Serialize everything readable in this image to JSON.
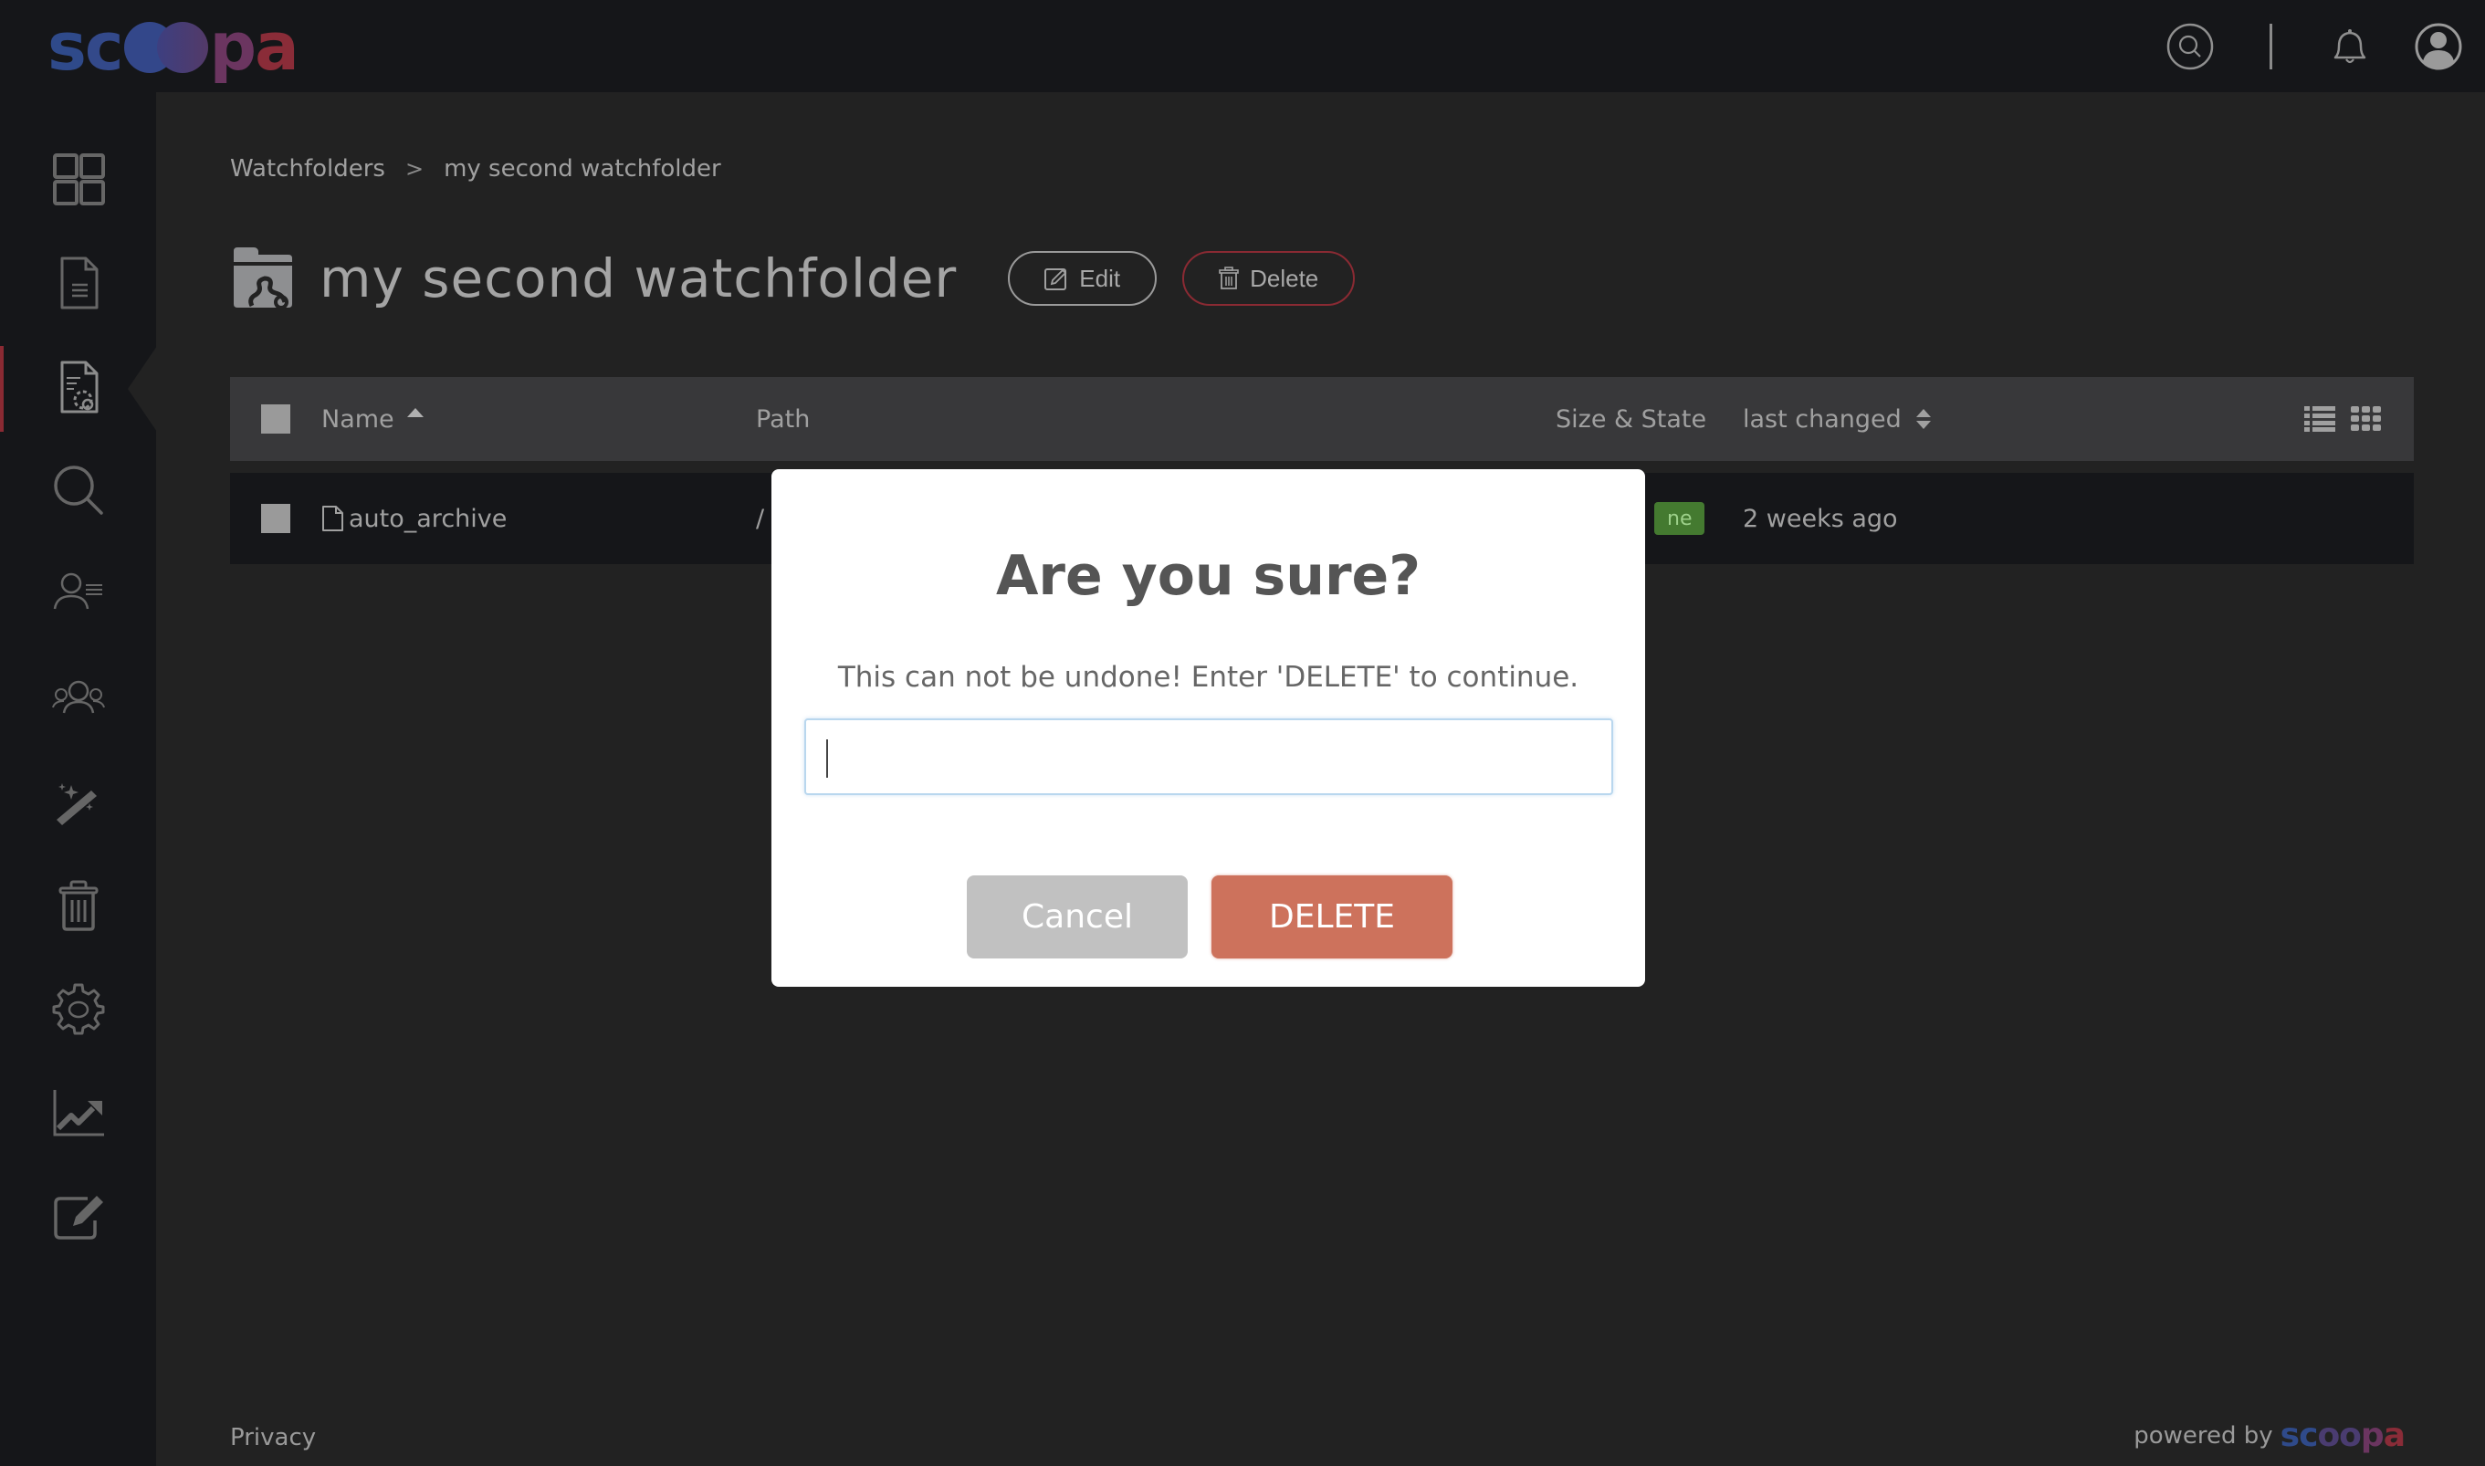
{
  "app": {
    "logo_text": "scoopa",
    "logo_colors": {
      "blue": "#2f4a8a",
      "purple": "#6b3560",
      "red": "#8a2c38"
    }
  },
  "topbar": {
    "icons": [
      "search-icon",
      "bell-icon",
      "user-avatar-icon"
    ]
  },
  "sidebar": {
    "items": [
      {
        "name": "dashboard",
        "icon": "grid-icon",
        "active": false
      },
      {
        "name": "documents",
        "icon": "document-icon",
        "active": false
      },
      {
        "name": "watchfolders",
        "icon": "document-gear-icon",
        "active": true
      },
      {
        "name": "search",
        "icon": "search-icon",
        "active": false
      },
      {
        "name": "user-list",
        "icon": "user-list-icon",
        "active": false
      },
      {
        "name": "groups",
        "icon": "users-group-icon",
        "active": false
      },
      {
        "name": "magic",
        "icon": "magic-wand-icon",
        "active": false
      },
      {
        "name": "trash",
        "icon": "trash-icon",
        "active": false
      },
      {
        "name": "settings",
        "icon": "gear-icon",
        "active": false
      },
      {
        "name": "statistics",
        "icon": "chart-icon",
        "active": false
      },
      {
        "name": "edit",
        "icon": "edit-icon",
        "active": false
      }
    ],
    "active_color": "#8a2a33"
  },
  "breadcrumb": {
    "items": [
      "Watchfolders",
      "my second watchfolder"
    ],
    "separator": ">"
  },
  "page": {
    "title": "my second watchfolder",
    "edit_label": "Edit",
    "delete_label": "Delete"
  },
  "table": {
    "columns": {
      "name": "Name",
      "path": "Path",
      "size_state": "Size & State",
      "last_changed": "last changed"
    },
    "rows": [
      {
        "name": "auto_archive",
        "path": "/",
        "state": "ne",
        "last_changed": "2 weeks ago"
      }
    ],
    "state_color": "#447a30"
  },
  "modal": {
    "title": "Are you sure?",
    "message": "This can not be undone! Enter 'DELETE' to continue.",
    "input_value": "",
    "cancel_label": "Cancel",
    "confirm_label": "DELETE",
    "confirm_color": "#cd725c",
    "cancel_color": "#c1c1c1"
  },
  "footer": {
    "privacy_label": "Privacy",
    "powered_by_label": "powered by",
    "powered_by_brand": "scoopa"
  }
}
